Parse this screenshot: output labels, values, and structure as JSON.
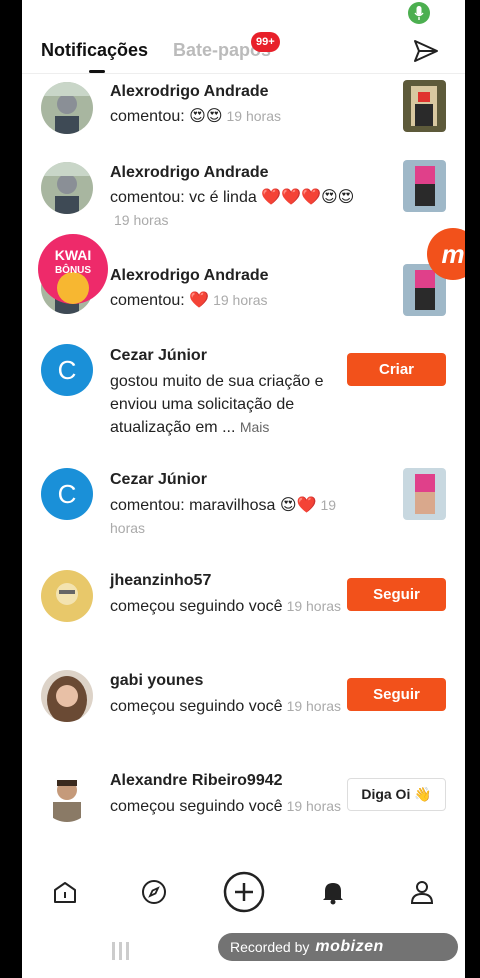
{
  "header": {
    "tab_notifications": "Notificações",
    "tab_chats": "Bate-papos",
    "chat_badge": "99+"
  },
  "notifications": [
    {
      "name": "Alexrodrigo Andrade",
      "text": "comentou: 😍😍",
      "time": "19 horas",
      "thumb": true
    },
    {
      "name": "Alexrodrigo Andrade",
      "text": "comentou: vc é linda ❤️❤️❤️😍😍",
      "time": "19 horas",
      "thumb": true
    },
    {
      "name": "Alexrodrigo Andrade",
      "text": "comentou: ❤️",
      "time": "19 horas",
      "thumb": true
    },
    {
      "name": "Cezar Júnior",
      "text": "gostou muito de sua criação e enviou uma solicitação de atualização em ...",
      "more": "Mais",
      "action": "Criar",
      "avatar_letter": "C"
    },
    {
      "name": "Cezar Júnior",
      "text": "comentou: maravilhosa 😍❤️",
      "time": "19 horas",
      "thumb": true,
      "avatar_letter": "C"
    },
    {
      "name": "jheanzinho57",
      "text": "começou seguindo você",
      "time": "19 horas",
      "action": "Seguir"
    },
    {
      "name": "gabi younes",
      "text": "começou seguindo você",
      "time": "19 horas",
      "action": "Seguir"
    },
    {
      "name": "Alexandre Ribeiro9942",
      "text": "começou seguindo você",
      "time": "19 horas",
      "action": "Diga Oi 👋"
    }
  ],
  "overlays": {
    "kwai_line1": "KWAI",
    "kwai_line2": "BÔNUS",
    "m_letter": "m"
  },
  "bottom_nav": [
    "home-icon",
    "explore-icon",
    "create-icon",
    "notifications-icon",
    "profile-icon"
  ],
  "recorder": {
    "label": "Recorded by",
    "brand": "mobizen"
  },
  "colors": {
    "accent": "#f2511b",
    "badge": "#e8202a",
    "avatar_c": "#1a90d8"
  }
}
